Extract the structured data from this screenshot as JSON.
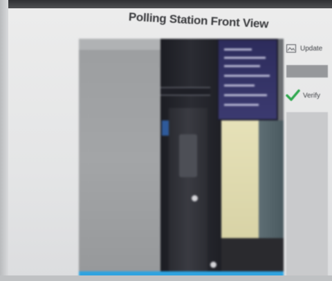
{
  "window": {
    "title": "Polling Station Front View"
  },
  "controls": {
    "update_label": "Update",
    "verify_label": "Verify"
  },
  "icons": {
    "update": "image-refresh-icon",
    "verify": "checkmark-icon"
  },
  "colors": {
    "verify_check": "#2fa84f",
    "camera_status_bar": "#2ea3e0"
  }
}
